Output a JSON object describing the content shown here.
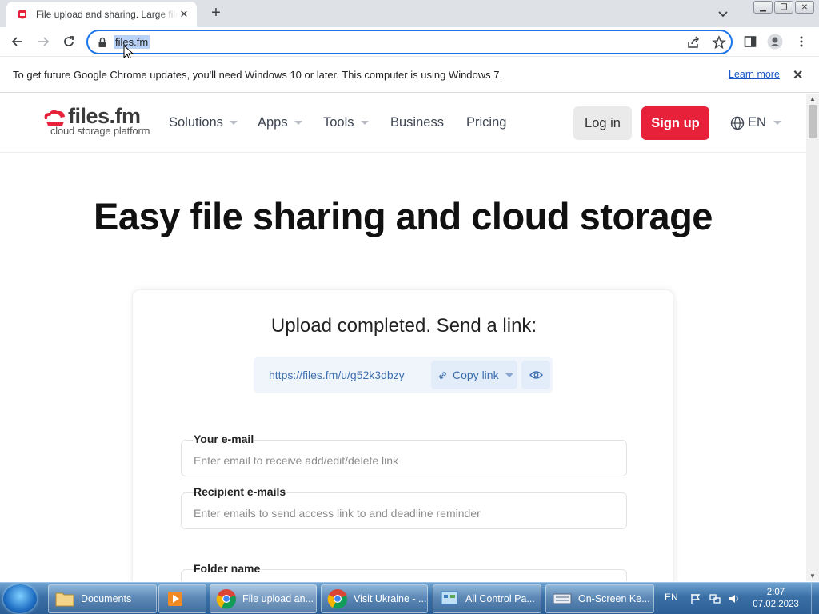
{
  "browser": {
    "tab_title": "File upload and sharing. Large files",
    "url": "files.fm",
    "update_message": "To get future Google Chrome updates, you'll need Windows 10 or later. This computer is using Windows 7.",
    "learn_more": "Learn more"
  },
  "site": {
    "logo_name": "files.fm",
    "logo_tagline": "cloud storage platform",
    "nav": [
      "Solutions",
      "Apps",
      "Tools",
      "Business",
      "Pricing"
    ],
    "login": "Log in",
    "signup": "Sign up",
    "language": "EN"
  },
  "hero_title": "Easy file sharing and cloud storage",
  "upload": {
    "heading": "Upload completed. Send a link:",
    "link": "https://files.fm/u/g52k3dbzy",
    "copy_link": "Copy link"
  },
  "form": {
    "email_label": "Your e-mail",
    "email_placeholder": "Enter email to receive add/edit/delete link",
    "recipients_label": "Recipient e-mails",
    "recipients_placeholder": "Enter emails to send access link to and deadline reminder",
    "folder_label": "Folder name"
  },
  "taskbar": {
    "items": [
      "Documents",
      "",
      "File upload an...",
      "Visit Ukraine - ...",
      "All Control Pa...",
      "On-Screen Ke..."
    ],
    "lang": "EN",
    "time": "2:07",
    "date": "07.02.2023"
  },
  "colors": {
    "brand_red": "#e8213a",
    "link_blue": "#3d6fb0",
    "omnibox_focus": "#1a73e8"
  }
}
